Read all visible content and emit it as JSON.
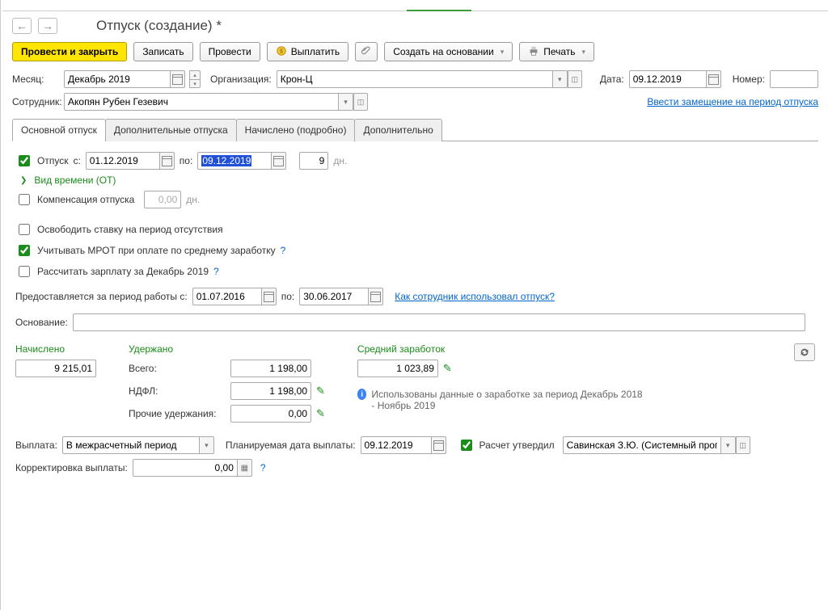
{
  "title": "Отпуск (создание) *",
  "nav": {
    "back": "←",
    "fwd": "→"
  },
  "toolbar": {
    "post_close": "Провести и закрыть",
    "save": "Записать",
    "post": "Провести",
    "pay": "Выплатить",
    "create_based": "Создать на основании",
    "print": "Печать"
  },
  "header": {
    "month_lbl": "Месяц:",
    "month_val": "Декабрь 2019",
    "org_lbl": "Организация:",
    "org_val": "Крон-Ц",
    "date_lbl": "Дата:",
    "date_val": "09.12.2019",
    "num_lbl": "Номер:",
    "num_val": "",
    "emp_lbl": "Сотрудник:",
    "emp_val": "Акопян Рубен Гезевич",
    "sub_link": "Ввести замещение на период отпуска"
  },
  "tabs": [
    "Основной отпуск",
    "Дополнительные отпуска",
    "Начислено (подробно)",
    "Дополнительно"
  ],
  "main": {
    "otpusk_chk": "Отпуск",
    "from_lbl": "с:",
    "from_val": "01.12.2019",
    "to_lbl": "по:",
    "to_val": "09.12.2019",
    "days_val": "9",
    "days_lbl": "дн.",
    "time_type": "Вид времени (ОТ)",
    "comp_chk": "Компенсация отпуска",
    "comp_val": "0,00",
    "comp_lbl": "дн.",
    "free_chk": "Освободить ставку на период отсутствия",
    "mrot_chk": "Учитывать МРОТ при оплате по среднему заработку",
    "calc_chk": "Рассчитать зарплату за Декабрь 2019",
    "period_lbl": "Предоставляется за период работы с:",
    "period_from": "01.07.2016",
    "period_to_lbl": "по:",
    "period_to": "30.06.2017",
    "usage_link": "Как сотрудник использовал отпуск?",
    "basis_lbl": "Основание:"
  },
  "totals": {
    "accrued_hdr": "Начислено",
    "accrued_val": "9 215,01",
    "deducted_hdr": "Удержано",
    "deducted_total_lbl": "Всего:",
    "deducted_total_val": "1 198,00",
    "ndfl_lbl": "НДФЛ:",
    "ndfl_val": "1 198,00",
    "other_lbl": "Прочие удержания:",
    "other_val": "0,00",
    "avg_hdr": "Средний заработок",
    "avg_val": "1 023,89",
    "info_text": "Использованы данные о заработке за период Декабрь 2018 - Ноябрь 2019"
  },
  "payout": {
    "lbl": "Выплата:",
    "type": "В межрасчетный период",
    "plan_lbl": "Планируемая дата выплаты:",
    "plan_val": "09.12.2019",
    "approved_lbl": "Расчет утвердил",
    "approver": "Савинская З.Ю. (Системный прог",
    "corr_lbl": "Корректировка выплаты:",
    "corr_val": "0,00"
  }
}
